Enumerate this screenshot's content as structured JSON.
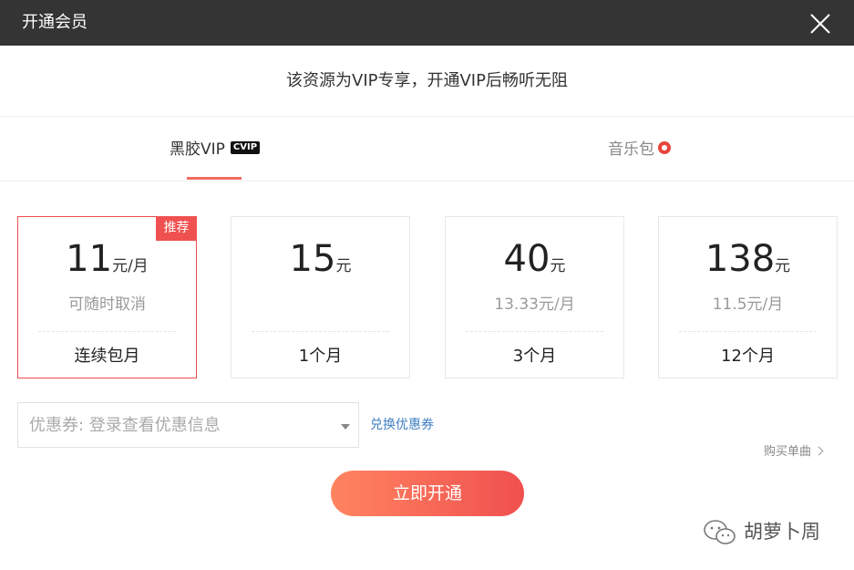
{
  "window": {
    "title": "开通会员",
    "close_icon": "close-icon"
  },
  "notice": "该资源为VIP专享，开通VIP后畅听无阻",
  "tabs": {
    "vip": {
      "label": "黑胶VIP",
      "badge": "CVIP"
    },
    "music": {
      "label": "音乐包"
    }
  },
  "plans": [
    {
      "amount": "11",
      "unit": "元/月",
      "sub": "可随时取消",
      "duration": "连续包月",
      "ribbon": "推荐",
      "selected": true
    },
    {
      "amount": "15",
      "unit": "元",
      "sub": "",
      "duration": "1个月",
      "selected": false
    },
    {
      "amount": "40",
      "unit": "元",
      "sub": "13.33元/月",
      "duration": "3个月",
      "selected": false
    },
    {
      "amount": "138",
      "unit": "元",
      "sub": "11.5元/月",
      "duration": "12个月",
      "selected": false
    }
  ],
  "coupon": {
    "placeholder": "优惠券: 登录查看优惠信息",
    "redeem_label": "兑换优惠券"
  },
  "buy_single_label": "购买单曲",
  "cta_label": "立即开通",
  "watermark": "胡萝卜周",
  "colors": {
    "accent": "#f36b5e",
    "cta_start": "#ff8460",
    "cta_end": "#f0504f",
    "link": "#3f7fc1",
    "titlebar": "#343434"
  }
}
